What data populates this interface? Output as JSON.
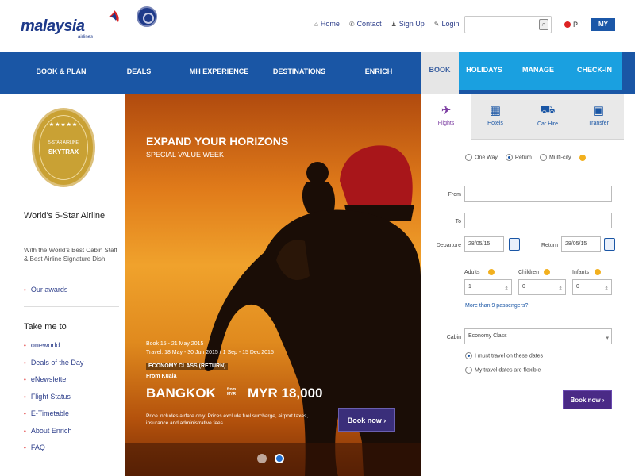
{
  "header": {
    "logo_text": "malaysia",
    "logo_sub": "airlines",
    "links": [
      {
        "icon": "home-icon",
        "label": "Home"
      },
      {
        "icon": "contact-icon",
        "label": "Contact"
      },
      {
        "icon": "signup-icon",
        "label": "Sign Up"
      },
      {
        "icon": "login-icon",
        "label": "Login"
      }
    ],
    "language": "P",
    "currency": "MY"
  },
  "nav": {
    "items": [
      "BOOK & PLAN",
      "DEALS",
      "MH EXPERIENCE",
      "DESTINATIONS",
      "ENRICH"
    ]
  },
  "booking_tabs": [
    "BOOK",
    "HOLIDAYS",
    "MANAGE",
    "CHECK-IN"
  ],
  "sidebar": {
    "badge_stars": "★★★★★",
    "badge_small": "5-STAR AIRLINE",
    "badge_main": "SKYTRAX",
    "award_title": "World's 5-Star Airline",
    "award_desc": "With the World's Best Cabin Staff & Best Airline Signature Dish",
    "award_link": "Our awards",
    "takeme_title": "Take me to",
    "quick_links": [
      "oneworld",
      "Deals of the Day",
      "eNewsletter",
      "Flight Status",
      "E-Timetable",
      "About Enrich",
      "FAQ"
    ]
  },
  "hero": {
    "title": "EXPAND YOUR HORIZONS",
    "subtitle": "SPECIAL VALUE WEEK",
    "book_period": "Book 15 - 21 May 2015",
    "travel_period": "Travel: 18 May - 30 Jun 2015 / 1 Sep - 15 Dec 2015",
    "class_label": "ECONOMY CLASS (RETURN)",
    "from_label": "From Kuala",
    "city": "BANGKOK",
    "price_small": "from MYR",
    "price": "MYR 18,000",
    "fine_print": "Price includes airfare only. Prices exclude fuel surcharge, airport taxes, insurance and administrative fees",
    "cta": "Book now ›",
    "slide_dots": [
      false,
      true
    ]
  },
  "panel": {
    "travel_types": [
      {
        "icon": "plane-icon",
        "label": "Flights",
        "active": true
      },
      {
        "icon": "hotel-icon",
        "label": "Hotels",
        "active": false
      },
      {
        "icon": "car-hire-icon",
        "label": "Car Hire",
        "active": false
      },
      {
        "icon": "transfer-icon",
        "label": "Transfer",
        "active": false
      }
    ],
    "trip_types": [
      {
        "label": "One Way",
        "selected": false
      },
      {
        "label": "Return",
        "selected": true
      },
      {
        "label": "Multi-city",
        "selected": false
      }
    ],
    "from_label": "From",
    "to_label": "To",
    "departure_label": "Departure",
    "departure_value": "28/05/15",
    "return_label": "Return",
    "return_value": "28/05/15",
    "adults_label": "Adults",
    "adults_value": "1",
    "children_label": "Children",
    "children_value": "0",
    "infants_label": "Infants",
    "infants_value": "0",
    "more_link": "More than 9 passengers?",
    "cabin_label": "Cabin",
    "cabin_value": "Economy Class",
    "opt_fixed": "I must travel on these dates",
    "opt_flexible": "My travel dates are flexible",
    "search_btn": "Book now ›"
  }
}
